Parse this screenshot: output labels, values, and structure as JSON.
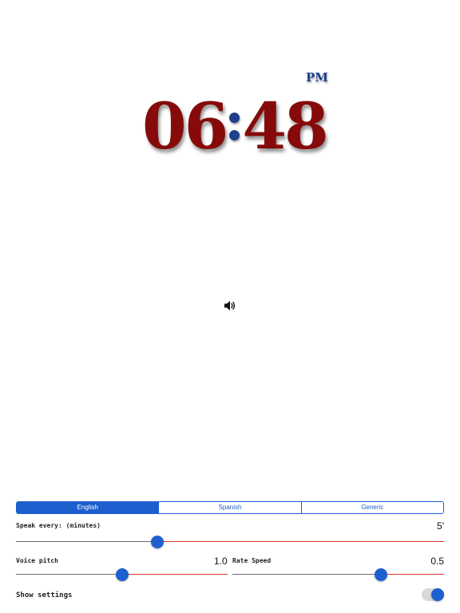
{
  "clock": {
    "ampm": "PM",
    "hours": "06",
    "minutes": "48"
  },
  "speaker": {
    "icon": "speaker-volume-icon"
  },
  "language": {
    "tabs": [
      {
        "label": "English",
        "selected": true
      },
      {
        "label": "Spanish",
        "selected": false
      },
      {
        "label": "Generic",
        "selected": false
      }
    ]
  },
  "settings": {
    "speak_every": {
      "label": "Speak every: (minutes)",
      "value": "5'",
      "fraction": 0.33
    },
    "voice_pitch": {
      "label": "Voice pitch",
      "value": "1.0",
      "fraction": 0.5
    },
    "rate_speed": {
      "label": "Rate Speed",
      "value": "0.5",
      "fraction": 0.7
    },
    "show_settings": {
      "label": "Show settings",
      "on": true
    }
  },
  "colors": {
    "accent": "#1d5fcf",
    "clock_digits": "#860a0a",
    "clock_colon": "#1f3f8a",
    "track_max": "#d43a2a",
    "track_min": "#6e6e6e"
  }
}
